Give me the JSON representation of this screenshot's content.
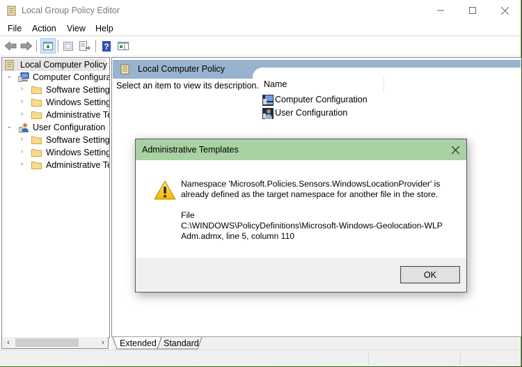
{
  "window": {
    "title": "Local Group Policy Editor",
    "icon": "policy-scroll-icon",
    "controls": {
      "minimize": "minimize-icon",
      "maximize": "maximize-icon",
      "close": "close-icon"
    }
  },
  "menu": [
    "File",
    "Action",
    "View",
    "Help"
  ],
  "toolbar": [
    {
      "name": "back",
      "icon": "back-arrow-icon"
    },
    {
      "name": "forward",
      "icon": "forward-arrow-icon"
    },
    {
      "name": "show-hide-console-tree",
      "icon": "console-tree-icon",
      "active": true
    },
    {
      "name": "properties",
      "icon": "properties-icon"
    },
    {
      "name": "export-list",
      "icon": "export-list-icon"
    },
    {
      "name": "help",
      "icon": "help-icon"
    },
    {
      "name": "show-hide-action-pane",
      "icon": "action-pane-icon"
    }
  ],
  "tree": {
    "root": "Local Computer Policy",
    "nodes": [
      {
        "label": "Computer Configura",
        "expanded": true,
        "icon": "computer-icon"
      },
      {
        "label": "Software Settings",
        "icon": "folder-icon"
      },
      {
        "label": "Windows Setting",
        "icon": "folder-icon"
      },
      {
        "label": "Administrative Te",
        "icon": "folder-icon"
      },
      {
        "label": "User Configuration",
        "expanded": true,
        "icon": "user-icon"
      },
      {
        "label": "Software Settings",
        "icon": "folder-icon"
      },
      {
        "label": "Windows Setting",
        "icon": "folder-icon"
      },
      {
        "label": "Administrative Te",
        "icon": "folder-icon"
      }
    ]
  },
  "details": {
    "header": "Local Computer Policy",
    "description": "Select an item to view its description.",
    "column_name": "Name",
    "items": [
      {
        "label": "Computer Configuration",
        "icon": "computer-icon"
      },
      {
        "label": "User Configuration",
        "icon": "user-icon"
      }
    ]
  },
  "tabs": [
    {
      "label": "Extended",
      "selected": true
    },
    {
      "label": "Standard",
      "selected": false
    }
  ],
  "dialog": {
    "title": "Administrative Templates",
    "icon": "warning-icon",
    "message_line1": "Namespace 'Microsoft.Policies.Sensors.WindowsLocationProvider' is",
    "message_line2": "already defined as the target namespace for another file in the store.",
    "file_label": "File",
    "file_path": "C:\\WINDOWS\\PolicyDefinitions\\Microsoft-Windows-Geolocation-WLP",
    "file_location": "Adm.admx, line 5, column 110",
    "ok_label": "OK"
  },
  "colors": {
    "dialog_title_bg": "#a8d1a4",
    "details_header_bg": "#98b3d0",
    "toolbar_active_bg": "#cce4f7"
  }
}
